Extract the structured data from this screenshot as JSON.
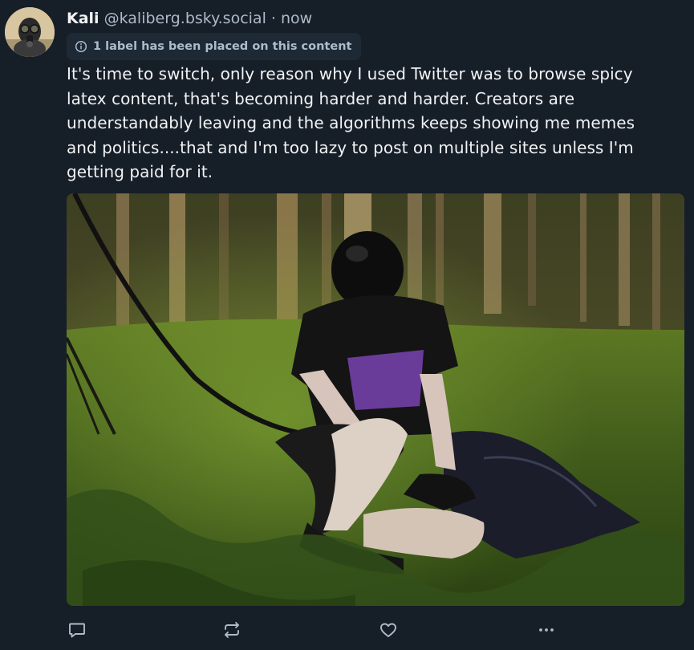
{
  "post": {
    "author": {
      "display_name": "Kali",
      "handle": "@kaliberg.bsky.social",
      "separator": "·",
      "time": "now"
    },
    "label_notice": "1 label has been placed on this content",
    "text_lines": [
      "It's time to switch, only reason why I used Twitter was to browse spicy",
      "latex content, that's becoming harder and harder.  Creators are",
      "understandably leaving and the algorithms keeps showing me memes",
      "and politics....that and I'm too lazy to post on multiple sites unless I'm",
      "getting paid for it."
    ],
    "actions": {
      "reply_icon": "speech-bubble-icon",
      "repost_icon": "repost-arrows-icon",
      "like_icon": "heart-icon",
      "more_icon": "ellipsis-icon"
    }
  },
  "colors": {
    "background": "#161e27",
    "primary_text": "#f1f3f5",
    "secondary_text": "#aebbc9",
    "chip_background": "#1e2936",
    "icon": "#aebbc9"
  }
}
